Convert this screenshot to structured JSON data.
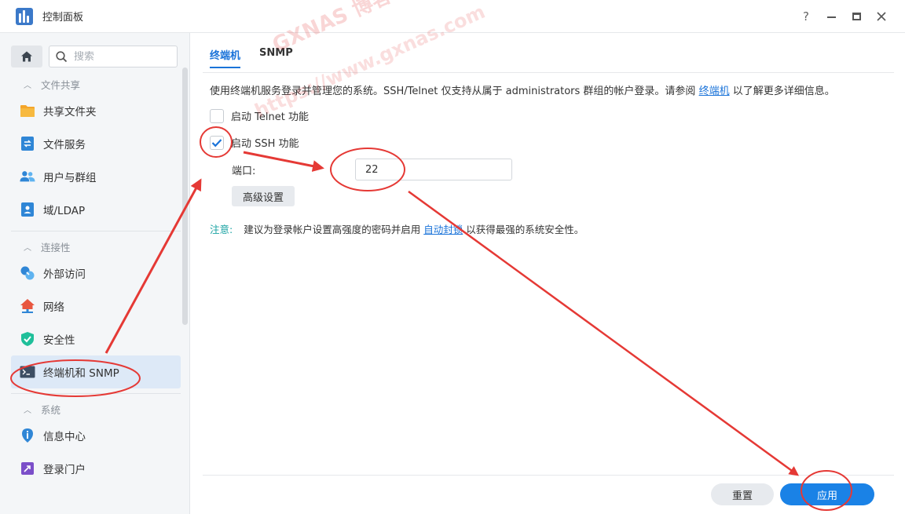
{
  "window": {
    "title": "控制面板",
    "icon": "control-panel-icon",
    "controls": {
      "help": "?"
    }
  },
  "sidebar": {
    "search_placeholder": "搜索",
    "groups": [
      {
        "label": "文件共享",
        "items": [
          {
            "label": "共享文件夹",
            "icon": "folder-icon"
          },
          {
            "label": "文件服务",
            "icon": "file-services-icon"
          },
          {
            "label": "用户与群组",
            "icon": "users-icon"
          },
          {
            "label": "域/LDAP",
            "icon": "ldap-icon"
          }
        ]
      },
      {
        "label": "连接性",
        "items": [
          {
            "label": "外部访问",
            "icon": "external-access-icon"
          },
          {
            "label": "网络",
            "icon": "network-icon"
          },
          {
            "label": "安全性",
            "icon": "security-shield-icon"
          },
          {
            "label": "终端机和 SNMP",
            "icon": "terminal-icon",
            "active": true
          }
        ]
      },
      {
        "label": "系统",
        "items": [
          {
            "label": "信息中心",
            "icon": "info-icon"
          },
          {
            "label": "登录门户",
            "icon": "login-portal-icon"
          }
        ]
      }
    ]
  },
  "main": {
    "tabs": [
      {
        "label": "终端机",
        "active": true
      },
      {
        "label": "SNMP",
        "active": false
      }
    ],
    "description": {
      "text_before": "使用终端机服务登录并管理您的系统。SSH/Telnet 仅支持从属于 administrators 群组的帐户登录。请参阅",
      "link": "终端机",
      "text_after": "以了解更多详细信息。"
    },
    "telnet": {
      "label": "启动 Telnet 功能",
      "checked": false
    },
    "ssh": {
      "label": "启动 SSH 功能",
      "checked": true
    },
    "port": {
      "label": "端口:",
      "value": "22"
    },
    "advanced_button": "高级设置",
    "note": {
      "label": "注意:",
      "text_before": "建议为登录帐户设置高强度的密码并启用",
      "link": "自动封锁",
      "text_after": "以获得最强的系统安全性。"
    },
    "footer": {
      "reset": "重置",
      "apply": "应用"
    }
  },
  "watermark": {
    "line1": "GXNAS 博客",
    "line2": "https://www.gxnas.com"
  },
  "colors": {
    "accent": "#1a82e6",
    "annotation": "#e53935",
    "sidebar_bg": "#f4f6f8",
    "active_item_bg": "#dde9f7"
  }
}
